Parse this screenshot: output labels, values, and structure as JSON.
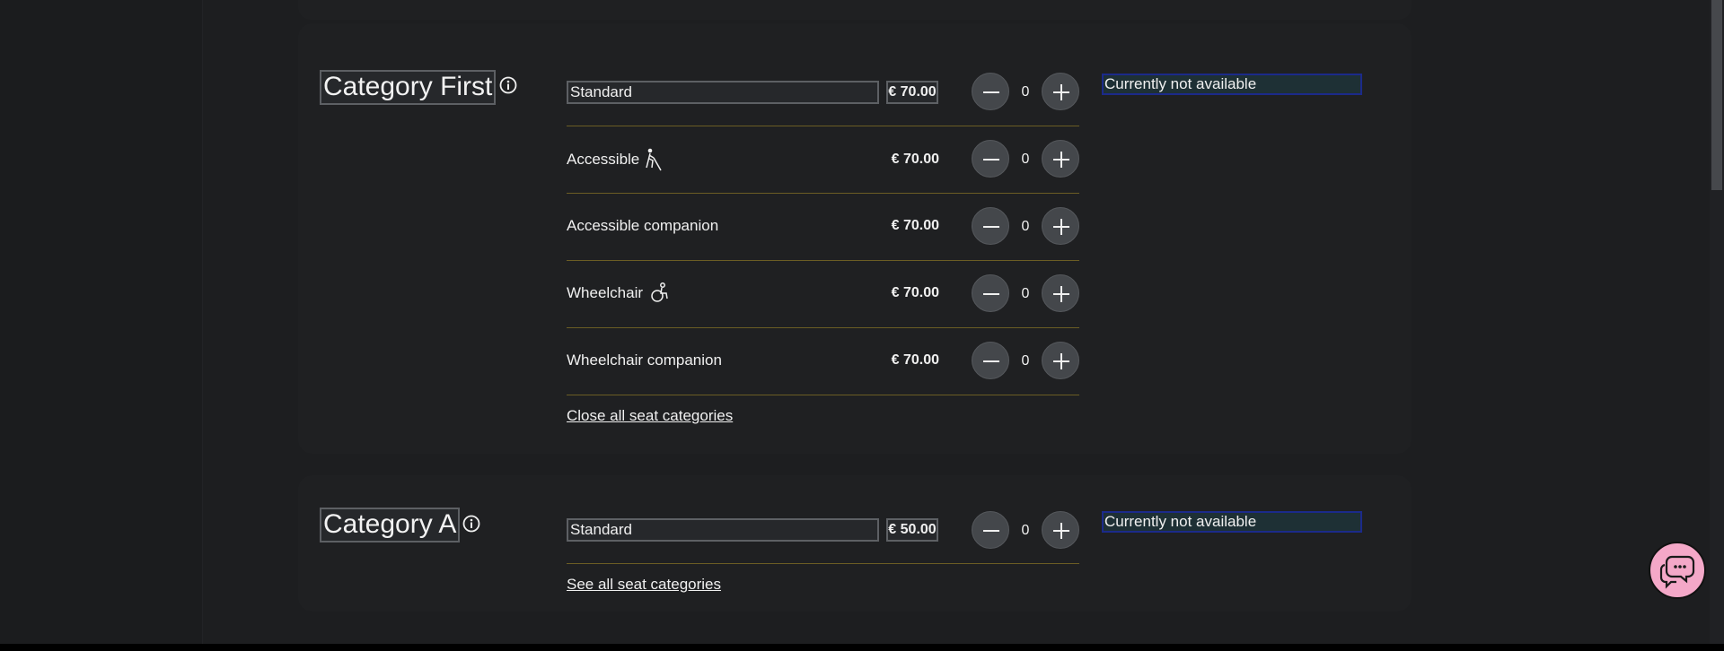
{
  "categories": [
    {
      "title": "Category First",
      "availability": "Currently not available",
      "footer_link": "Close all seat categories",
      "rows": [
        {
          "label": "Standard",
          "price": "€ 70.00",
          "qty": "0"
        },
        {
          "label": "Accessible",
          "price": "€ 70.00",
          "qty": "0",
          "icon": "blind-person-icon"
        },
        {
          "label": "Accessible companion",
          "price": "€ 70.00",
          "qty": "0"
        },
        {
          "label": "Wheelchair",
          "price": "€ 70.00",
          "qty": "0",
          "icon": "wheelchair-icon"
        },
        {
          "label": "Wheelchair companion",
          "price": "€ 70.00",
          "qty": "0"
        }
      ]
    },
    {
      "title": "Category A",
      "availability": "Currently not available",
      "footer_link": "See all seat categories",
      "rows": [
        {
          "label": "Standard",
          "price": "€ 50.00",
          "qty": "0"
        }
      ]
    }
  ],
  "icons": {
    "info": "info-icon",
    "minus": "minus-icon",
    "plus": "plus-icon",
    "chat": "chat-bubble-icon"
  },
  "colors": {
    "divider": "#6b5d24",
    "availability_border": "#1b2a8a",
    "chat_button": "#f4a8c8"
  }
}
